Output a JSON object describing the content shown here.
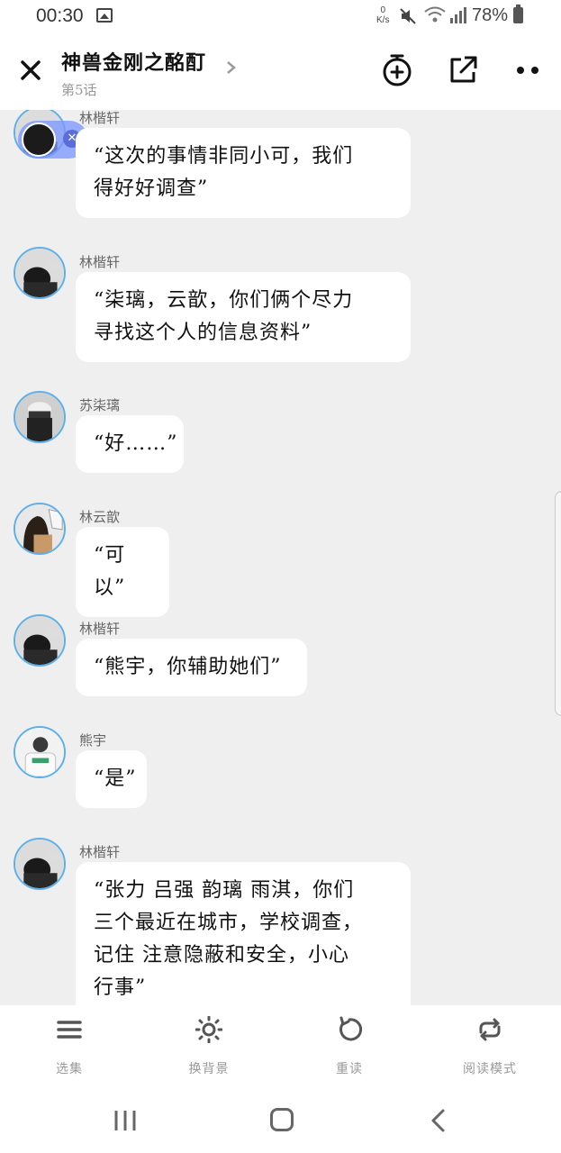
{
  "status_bar": {
    "time": "00:30",
    "net_speed_top": "0",
    "net_speed_unit": "K/s",
    "battery": "78%"
  },
  "header": {
    "title": "神兽金刚之酩酊",
    "subtitle": "第5话",
    "icons": [
      "close-icon",
      "chevron-right-icon",
      "add-timer-icon",
      "share-icon",
      "more-icon"
    ]
  },
  "messages": [
    {
      "name": "林楷轩",
      "text": "“这次的事情非同小可，我们得好好调查”",
      "lines": [
        "“这次的事情非同小可，我们",
        "得好好调查”"
      ]
    },
    {
      "name": "林楷轩",
      "text": "“柒璃，云歆，你们俩个尽力寻找这个人的信息资料”",
      "lines": [
        "“柒璃，云歆，你们俩个尽力",
        "寻找这个人的信息资料”"
      ]
    },
    {
      "name": "苏柒璃",
      "text": "“好……”",
      "lines": [
        "“好……”"
      ]
    },
    {
      "name": "林云歆",
      "text": "“可以”",
      "lines": [
        "“可以”"
      ]
    },
    {
      "name": "林楷轩",
      "text": "“熊宇，你辅助她们”",
      "lines": [
        "“熊宇，你辅助她们”"
      ]
    },
    {
      "name": "熊宇",
      "text": "“是”",
      "lines": [
        "“是”"
      ]
    },
    {
      "name": "林楷轩",
      "text": "“张力 吕强 韵璃 雨淇，你们三个最近在城市，学校调查，记住 注意隐蔽和安全，小心行事”",
      "lines": [
        "“张力 吕强 韵璃 雨淇，你们",
        "三个最近在城市，学校调查，",
        "记住 注意隐蔽和安全，小心",
        "行事”"
      ]
    }
  ],
  "toolbar": {
    "items": [
      {
        "label": "选集",
        "icon": "list-icon"
      },
      {
        "label": "换背景",
        "icon": "brightness-icon"
      },
      {
        "label": "重读",
        "icon": "replay-icon"
      },
      {
        "label": "阅读模式",
        "icon": "loop-icon"
      }
    ]
  },
  "colors": {
    "background": "#efefef",
    "bubble": "#ffffff",
    "avatar_ring": "#5fb0e8",
    "floater": "#7896ff"
  }
}
